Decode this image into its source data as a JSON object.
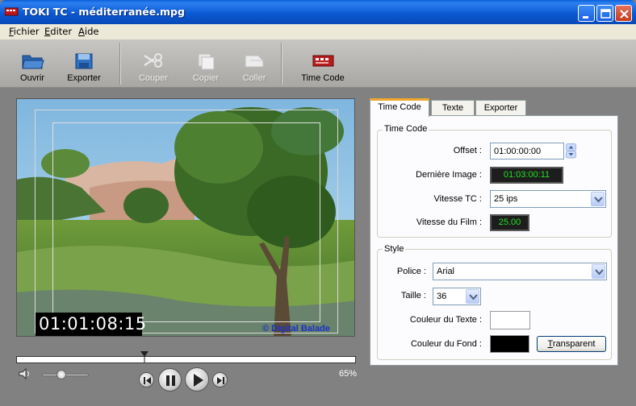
{
  "window": {
    "title": "TOKI TC - méditerranée.mpg",
    "controls": [
      "minimize-icon",
      "maximize-icon",
      "close-icon"
    ]
  },
  "menu": {
    "items": [
      {
        "accel": "F",
        "rest": "ichier"
      },
      {
        "accel": "E",
        "rest": "diter"
      },
      {
        "accel": "A",
        "rest": "ide"
      }
    ]
  },
  "toolbar": {
    "buttons": [
      {
        "label": "Ouvrir",
        "icon": "open-folder-icon",
        "enabled": true
      },
      {
        "label": "Exporter",
        "icon": "export-icon",
        "enabled": true
      },
      {
        "label": "Couper",
        "icon": "cut-scissors-icon",
        "enabled": false
      },
      {
        "label": "Copier",
        "icon": "copy-icon",
        "enabled": false
      },
      {
        "label": "Coller",
        "icon": "paste-icon",
        "enabled": false
      },
      {
        "label": "Time Code",
        "icon": "timecode-icon",
        "enabled": true
      }
    ]
  },
  "video": {
    "timecode_overlay": "01:01:08:15",
    "copyright": "© Digital Balade"
  },
  "transport": {
    "zoom": "65%",
    "buttons": [
      "previous-icon",
      "pause-icon",
      "play-icon",
      "next-icon"
    ]
  },
  "tabs": [
    {
      "label": "Time Code",
      "active": true
    },
    {
      "label": "Texte",
      "active": false
    },
    {
      "label": "Exporter",
      "active": false
    }
  ],
  "timecode_group": {
    "title": "Time Code",
    "offset_label": "Offset :",
    "offset_value": "01:00:00:00",
    "last_image_label": "Dernière Image :",
    "last_image_value": "01:03:00:11",
    "tc_speed_label": "Vitesse TC :",
    "tc_speed_value": "25 ips",
    "film_speed_label": "Vitesse du Film :",
    "film_speed_value": "25.00"
  },
  "style_group": {
    "title": "Style",
    "font_label": "Police :",
    "font_value": "Arial",
    "size_label": "Taille :",
    "size_value": "36",
    "text_color_label": "Couleur du Texte :",
    "text_color": "#ffffff",
    "bg_color_label": "Couleur du Fond :",
    "bg_color": "#000000",
    "transparent_accel": "T",
    "transparent_rest": "ransparent"
  },
  "colors": {
    "titlebar": "#0b5ad3",
    "lcd_text": "#24e024",
    "tab_highlight": "#f0a82c"
  }
}
